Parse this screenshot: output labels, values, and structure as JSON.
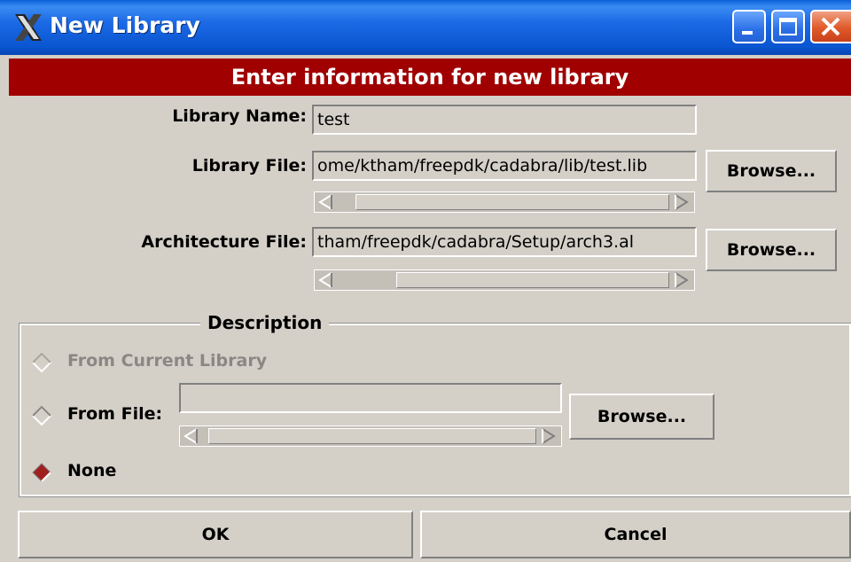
{
  "window": {
    "title": "New Library"
  },
  "header": {
    "text": "Enter information for new library"
  },
  "fields": {
    "library_name": {
      "label": "Library Name:",
      "value": "test"
    },
    "library_file": {
      "label": "Library File:",
      "value": "ome/ktham/freepdk/cadabra/lib/test.lib",
      "browse_label": "Browse..."
    },
    "architecture_file": {
      "label": "Architecture File:",
      "value": "tham/freepdk/cadabra/Setup/arch3.al",
      "browse_label": "Browse..."
    }
  },
  "description": {
    "legend": "Description",
    "options": [
      {
        "label": "From Current Library",
        "selected": false,
        "enabled": false
      },
      {
        "label": "From File:",
        "selected": false,
        "enabled": true
      },
      {
        "label": "None",
        "selected": true,
        "enabled": true
      }
    ],
    "from_file_value": "",
    "browse_label": "Browse..."
  },
  "buttons": {
    "ok": "OK",
    "cancel": "Cancel"
  },
  "colors": {
    "header_bg": "#a00000",
    "titlebar": "#0a55d0",
    "radio_selected": "#a02020"
  }
}
